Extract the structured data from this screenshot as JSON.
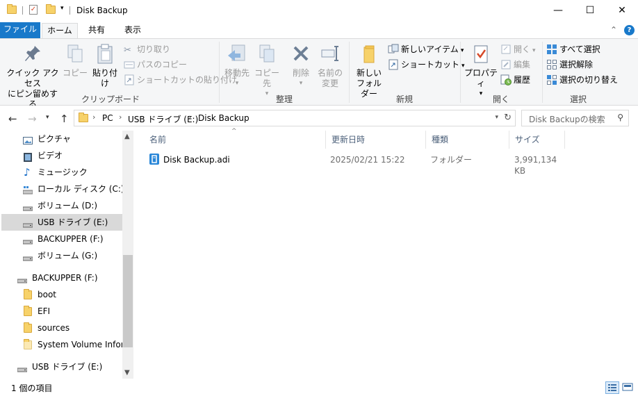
{
  "window": {
    "title": "Disk Backup",
    "minimize": "—",
    "maximize": "☐",
    "close": "✕"
  },
  "ribbon_tabs": [
    "ファイル",
    "ホーム",
    "共有",
    "表示"
  ],
  "ribbon": {
    "clipboard": {
      "label": "クリップボード",
      "pin_line1": "クイック アクセス",
      "pin_line2": "にピン留めする",
      "copy": "コピー",
      "paste": "貼り付け",
      "cut": "切り取り",
      "copy_path": "パスのコピー",
      "paste_shortcut": "ショートカットの貼り付け"
    },
    "organize": {
      "label": "整理",
      "move_to": "移動先",
      "copy_to": "コピー先",
      "delete": "削除",
      "rename_line1": "名前の",
      "rename_line2": "変更"
    },
    "new": {
      "label": "新規",
      "new_folder_line1": "新しい",
      "new_folder_line2": "フォルダー",
      "new_item": "新しいアイテム",
      "shortcut": "ショートカット"
    },
    "open": {
      "label": "開く",
      "properties": "プロパティ",
      "open": "開く",
      "edit": "編集",
      "history": "履歴"
    },
    "select": {
      "label": "選択",
      "select_all": "すべて選択",
      "select_none": "選択解除",
      "invert": "選択の切り替え"
    }
  },
  "address": {
    "crumbs": [
      "PC",
      "USB ドライブ (E:)",
      "Disk Backup"
    ],
    "search_placeholder": "Disk Backupの検索"
  },
  "nav_items": [
    {
      "label": "ピクチャ",
      "icon": "pictures-icon"
    },
    {
      "label": "ビデオ",
      "icon": "videos-icon"
    },
    {
      "label": "ミュージック",
      "icon": "music-icon"
    },
    {
      "label": "ローカル ディスク (C:)",
      "icon": "local-disk-icon"
    },
    {
      "label": "ボリューム (D:)",
      "icon": "drive-icon"
    },
    {
      "label": "USB ドライブ (E:)",
      "icon": "usb-drive-icon",
      "selected": true
    },
    {
      "label": "BACKUPPER (F:)",
      "icon": "drive-icon"
    },
    {
      "label": "ボリューム (G:)",
      "icon": "drive-icon"
    },
    {
      "label": "BACKUPPER (F:)",
      "icon": "drive-icon"
    },
    {
      "label": "boot",
      "icon": "folder-icon"
    },
    {
      "label": "EFI",
      "icon": "folder-icon"
    },
    {
      "label": "sources",
      "icon": "folder-icon"
    },
    {
      "label": "System Volume Information",
      "icon": "folder-icon"
    },
    {
      "label": "USB ドライブ (E:)",
      "icon": "usb-drive-icon"
    }
  ],
  "columns": [
    "名前",
    "更新日時",
    "種類",
    "サイズ"
  ],
  "files": [
    {
      "name": "Disk Backup.adi",
      "modified": "2025/02/21 15:22",
      "type": "フォルダー",
      "size": "3,991,134 KB"
    }
  ],
  "status": {
    "item_count": "1 個の項目"
  },
  "colors": {
    "accent": "#1979ca",
    "ribbon_bg": "#f5f6f7",
    "selected_bg": "#d9d9d9",
    "folder_yellow": "#f7d26a"
  }
}
